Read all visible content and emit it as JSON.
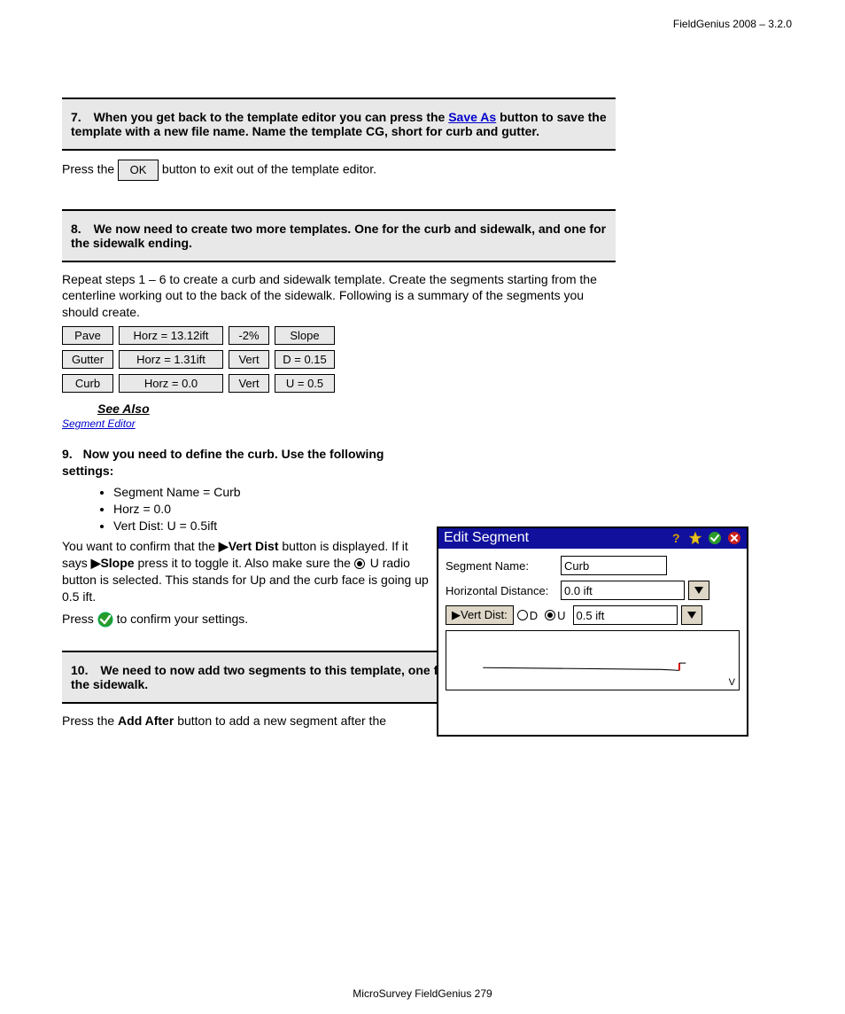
{
  "header_right": "FieldGenius 2008 – 3.2.0",
  "page_no": "279",
  "step7": {
    "num": "7.",
    "desc_before": "When you get back to the template editor you can press the ",
    "save_as": "Save As",
    "desc_after": " button to save the template with a new file name. Name the template CG, short for curb and gutter.",
    "note_before": "Press the ",
    "ok": "OK",
    "note_after": " button to exit out of the template editor."
  },
  "step8": {
    "num": "8.",
    "text": "We now need to create two more templates. One for the curb and sidewalk, and one for the sidewalk ending."
  },
  "step9pre": "Repeat steps 1 – 6 to create a curb and sidewalk template. Create the segments starting from the centerline working out to the back of the sidewalk. Following is a summary of the segments you should create.",
  "seg_table": {
    "r1": [
      "Pave",
      "Horz = 13.12ift",
      "-2%",
      "Slope"
    ],
    "r2": [
      "Gutter",
      "Horz = 1.31ift",
      "Vert",
      "D = 0.15"
    ],
    "r3": [
      "Curb",
      "Horz = 0.0",
      "Vert",
      "U = 0.5"
    ]
  },
  "seealso": {
    "label": "See Also",
    "link": "Segment Editor"
  },
  "step9": {
    "num": "9.",
    "desc": "Now you need to define the curb. Use the following settings:",
    "bullets": [
      "Segment Name = Curb",
      "Horz = 0.0",
      "Vert Dist: U = 0.5ift"
    ],
    "after_prefix_1": "You want to confirm that the ",
    "after_bold_1": "▶Vert Dist",
    "after_mid_1": " button is displayed. If it says ",
    "after_bold_2": "▶Slope",
    "after_mid_2": " press it to toggle it. Also make sure the ",
    "U": "U",
    "after_end": " radio button is selected. This stands for Up and the curb face is going up 0.5 ift.",
    "okconfirm_before": "Press ",
    "okconfirm_icon_note": "",
    "okconfirm_after": " to confirm your settings."
  },
  "dialog": {
    "title": "Edit Segment",
    "segname_label": "Segment Name:",
    "segname_value": "Curb",
    "horz_label": "Horizontal Distance:",
    "horz_value": "0.0 ift",
    "vert_btn": "▶Vert Dist:",
    "D": "D",
    "U": "U",
    "vert_value": "0.5 ift",
    "v": "V"
  },
  "step10": {
    "num": "10.",
    "text": "We need to now add two segments to this template, one for the boulevard and one for the sidewalk."
  },
  "step10_action_before": "Press the ",
  "step10_action_btn": "Add After",
  "step10_action_mid": " button to add a new segment after the",
  "footer": "MicroSurvey FieldGenius                                                                                                                                                          279"
}
